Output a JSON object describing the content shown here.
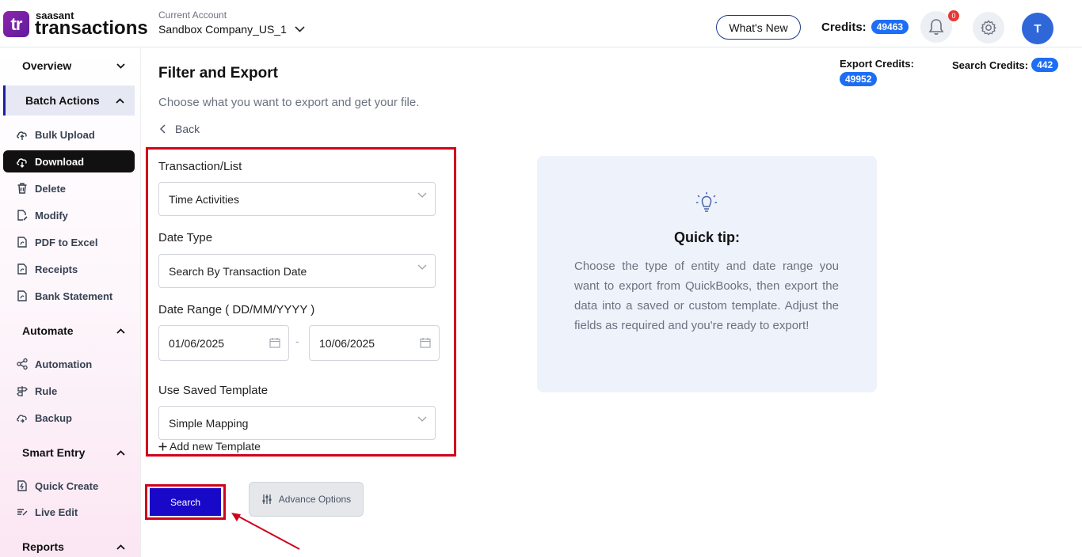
{
  "brand": {
    "logo_letters": "tr",
    "top": "saasant",
    "main": "transactions"
  },
  "header": {
    "account_label": "Current Account",
    "account_name": "Sandbox Company_US_1",
    "whats_new": "What's New",
    "credits_label": "Credits:",
    "credits_value": "49463",
    "notification_count": "0",
    "avatar_initial": "T"
  },
  "sidebar": {
    "overview": "Overview",
    "batch_actions": "Batch Actions",
    "batch_items": [
      "Bulk Upload",
      "Download",
      "Delete",
      "Modify",
      "PDF to Excel",
      "Receipts",
      "Bank Statement"
    ],
    "automate": "Automate",
    "automate_items": [
      "Automation",
      "Rule",
      "Backup"
    ],
    "smart_entry": "Smart Entry",
    "smart_entry_items": [
      "Quick Create",
      "Live Edit"
    ],
    "reports": "Reports"
  },
  "main": {
    "title": "Filter and Export",
    "subtitle": "Choose what you want to export and get your file.",
    "back": "Back",
    "export_credits_label": "Export Credits:",
    "export_credits_value": "49952",
    "search_credits_label": "Search Credits:",
    "search_credits_value": "442"
  },
  "form": {
    "transaction_label": "Transaction/List",
    "transaction_value": "Time Activities",
    "date_type_label": "Date Type",
    "date_type_value": "Search By Transaction Date",
    "date_range_label": "Date Range ( DD/MM/YYYY )",
    "date_from": "01/06/2025",
    "date_to": "10/06/2025",
    "range_separator": "-",
    "template_label": "Use Saved Template",
    "template_value": "Simple Mapping",
    "add_template": "Add new Template",
    "search_button": "Search",
    "advance_options": "Advance Options"
  },
  "tip": {
    "title": "Quick tip:",
    "body": "Choose the type of entity and date range you want to export from QuickBooks, then export the data into a saved or custom template. Adjust the fields as required and you're ready to export!"
  },
  "colors": {
    "accent": "#1d6ef5",
    "highlight": "#d0021b",
    "search_button": "#1808c8"
  }
}
